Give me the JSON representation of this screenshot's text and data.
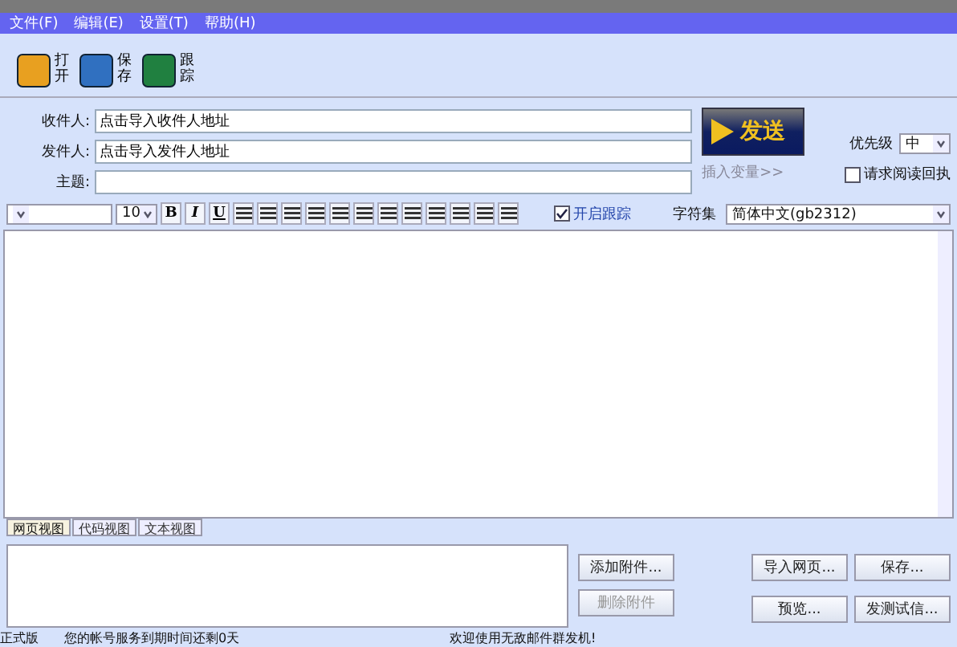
{
  "menu": [
    "文件(F)",
    "编辑(E)",
    "设置(T)",
    "帮助(H)"
  ],
  "toolbar": [
    {
      "label": "打开",
      "kind": "open"
    },
    {
      "label": "保存",
      "kind": "save"
    },
    {
      "label": "跟踪",
      "kind": "track"
    }
  ],
  "form": {
    "to_label": "收件人:",
    "to_value": "点击导入收件人地址",
    "from_label": "发件人:",
    "from_value": "点击导入发件人地址",
    "subject_label": "主题:",
    "send": "发送",
    "insert_var": "插入变量>>",
    "priority_label": "优先级",
    "priority": "中",
    "read_receipt": {
      "label": "请求阅读回执",
      "checked": false
    }
  },
  "format": {
    "size": "10",
    "buttons": [
      "B",
      "I",
      "U"
    ],
    "tracking": {
      "label": "开启跟踪",
      "checked": true
    },
    "charset_label": "字符集",
    "charset": "简体中文(gb2312)"
  },
  "view_tabs": [
    {
      "label": "网页视图",
      "selected": true
    },
    {
      "label": "代码视图",
      "selected": false
    },
    {
      "label": "文本视图",
      "selected": false
    }
  ],
  "attach_buttons": [
    {
      "label": "添加附件...",
      "disabled": false
    },
    {
      "label": "删除附件",
      "disabled": true
    }
  ],
  "action_buttons": [
    "导入网页...",
    "保存...",
    "预览...",
    "发测试信..."
  ],
  "status": [
    "正式版",
    "您的帐号服务到期时间还剩0天",
    "欢迎使用无敌邮件群发机!"
  ]
}
